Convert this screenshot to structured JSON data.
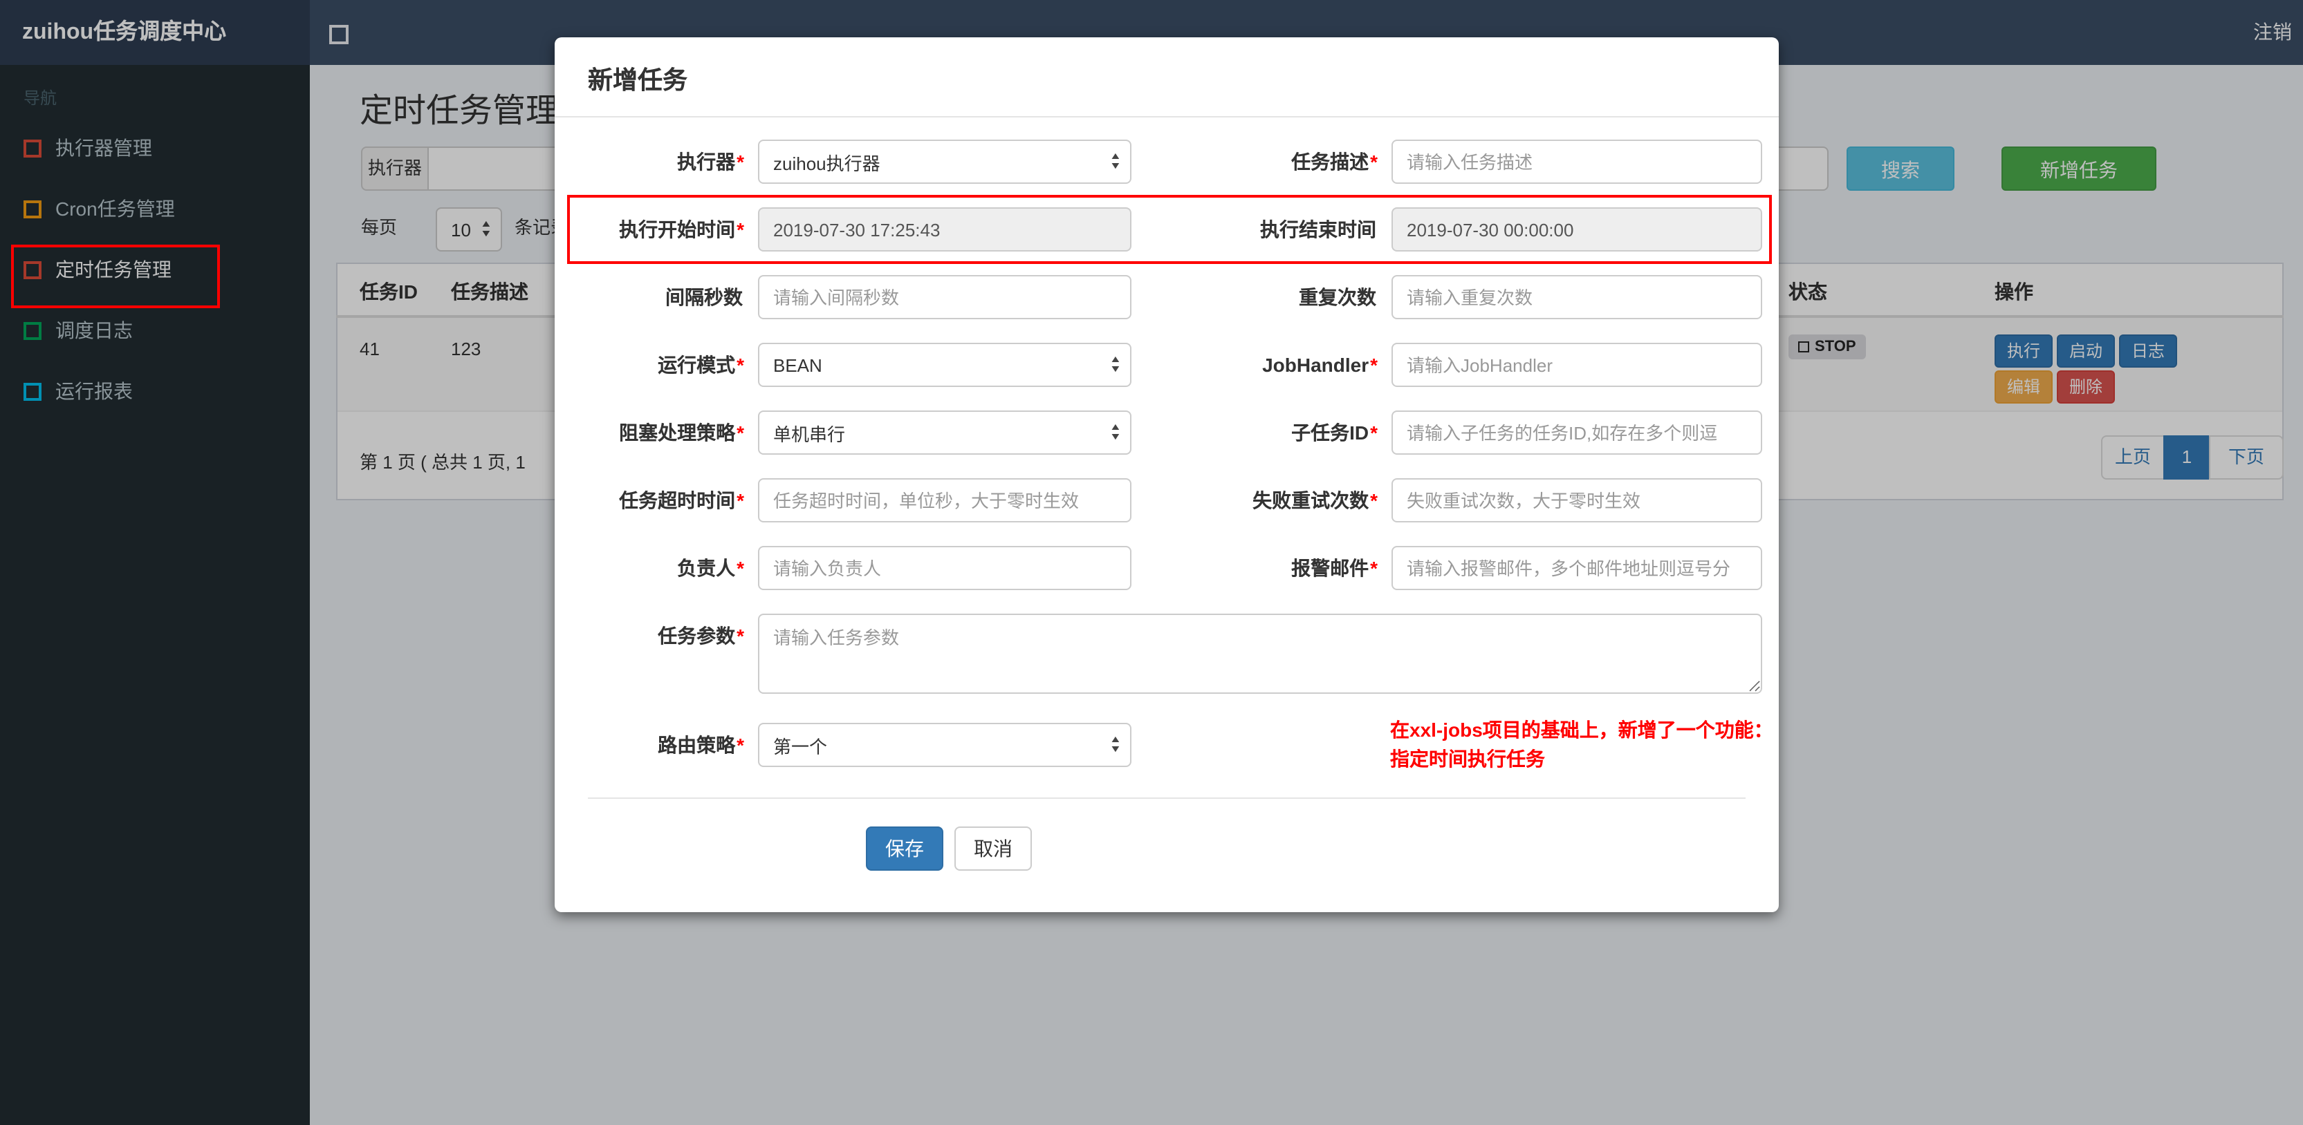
{
  "colors": {
    "primary": "#337ab7",
    "info": "#5bc0de",
    "success": "#4cae4c",
    "warning": "#f0ad4e",
    "danger": "#d9534f",
    "annotation": "#ff0000",
    "navbar": "#3b4e66",
    "sidebar": "#222d32"
  },
  "icons": {
    "select_up": "▲",
    "select_down": "▼"
  },
  "navbar": {
    "brand": "zuihou任务调度中心",
    "logout": "注销"
  },
  "sidebar": {
    "section": "导航",
    "items": [
      {
        "label": "执行器管理",
        "color": "#dd4b39"
      },
      {
        "label": "Cron任务管理",
        "color": "#f39c12"
      },
      {
        "label": "定时任务管理",
        "color": "#dd4b39"
      },
      {
        "label": "调度日志",
        "color": "#00a65a"
      },
      {
        "label": "运行报表",
        "color": "#00c0ef"
      }
    ]
  },
  "content": {
    "title": "定时任务管理",
    "executor_label": "执行器",
    "search_button": "搜索",
    "add_button": "新增任务",
    "per_page_label": "每页",
    "per_page_value": "10",
    "per_page_suffix": "条记录",
    "table": {
      "col_id": "任务ID",
      "col_desc": "任务描述",
      "col_status": "状态",
      "col_actions": "操作",
      "row": {
        "id": "41",
        "desc": "123",
        "status": "STOP",
        "btn_execute": "执行",
        "btn_start": "启动",
        "btn_log": "日志",
        "btn_edit": "编辑",
        "btn_delete": "删除"
      }
    },
    "summary": "第 1 页 ( 总共 1 页, 1",
    "pagination": {
      "prev": "上页",
      "current": "1",
      "next": "下页"
    }
  },
  "modal": {
    "title": "新增任务",
    "rows": [
      {
        "label": "执行器",
        "req": "*",
        "value": "zuihou执行器"
      },
      {
        "label": "任务描述",
        "req": "*",
        "placeholder": "请输入任务描述"
      },
      {
        "label": "执行开始时间",
        "req": "*",
        "value": "2019-07-30 17:25:43"
      },
      {
        "label": "执行结束时间",
        "req": "",
        "value": "2019-07-30 00:00:00"
      },
      {
        "label": "间隔秒数",
        "req": "",
        "placeholder": "请输入间隔秒数"
      },
      {
        "label": "重复次数",
        "req": "",
        "placeholder": "请输入重复次数"
      },
      {
        "label": "运行模式",
        "req": "*",
        "value": "BEAN"
      },
      {
        "label": "JobHandler",
        "req": "*",
        "placeholder": "请输入JobHandler"
      },
      {
        "label": "阻塞处理策略",
        "req": "*",
        "value": "单机串行"
      },
      {
        "label": "子任务ID",
        "req": "*",
        "placeholder": "请输入子任务的任务ID,如存在多个则逗"
      },
      {
        "label": "任务超时时间",
        "req": "*",
        "placeholder": "任务超时时间，单位秒，大于零时生效"
      },
      {
        "label": "失败重试次数",
        "req": "*",
        "placeholder": "失败重试次数，大于零时生效"
      },
      {
        "label": "负责人",
        "req": "*",
        "placeholder": "请输入负责人"
      },
      {
        "label": "报警邮件",
        "req": "*",
        "placeholder": "请输入报警邮件，多个邮件地址则逗号分"
      },
      {
        "label": "任务参数",
        "req": "*",
        "placeholder": "请输入任务参数"
      },
      {
        "label": "路由策略",
        "req": "*",
        "value": "第一个"
      }
    ],
    "note_line1": "在xxl-jobs项目的基础上，新增了一个功能：",
    "note_line2": "指定时间执行任务",
    "save": "保存",
    "cancel": "取消"
  }
}
